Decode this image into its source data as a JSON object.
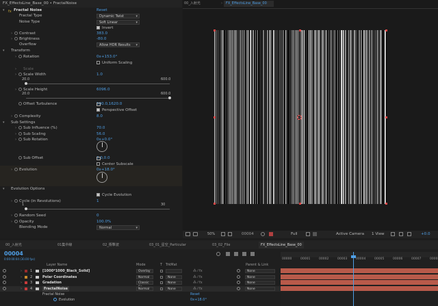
{
  "effect_controls": {
    "panel_title": "FX_EffectsLine_Base_00 • FractalNoise",
    "effect_name": "Fractal Noise",
    "reset_label": "Reset",
    "props": [
      {
        "label": "Fractal Type",
        "value": "Dynamic Twist"
      },
      {
        "label": "Noise Type",
        "value": "Soft Linear"
      },
      {
        "label": "",
        "value": "Invert"
      },
      {
        "label": "Contrast",
        "value": "383.0"
      },
      {
        "label": "Brightness",
        "value": "-80.0"
      },
      {
        "label": "Overflow",
        "value": "Allow HDR Results"
      },
      {
        "label": "Transform",
        "value": ""
      },
      {
        "label": "Rotation",
        "value": "0x+153.0°"
      },
      {
        "label": "",
        "value": "Uniform Scaling"
      },
      {
        "label": "Scale",
        "value": ""
      },
      {
        "label": "Scale Width",
        "value": "1.0"
      },
      {
        "label": "Scale Height",
        "value": "6096.0"
      },
      {
        "label": "Offset Turbulence",
        "value": "500.0,1620.0"
      },
      {
        "label": "",
        "value": "Perspective Offset"
      },
      {
        "label": "Complexity",
        "value": "8.0"
      },
      {
        "label": "Sub Settings",
        "value": ""
      },
      {
        "label": "Sub Influence (%)",
        "value": "70.0"
      },
      {
        "label": "Sub Scaling",
        "value": "56.0"
      },
      {
        "label": "Sub Rotation",
        "value": "0x+0.0°"
      },
      {
        "label": "Sub Offset",
        "value": "0.0,0.0"
      },
      {
        "label": "",
        "value": "Center Subscale"
      },
      {
        "label": "Evolution",
        "value": "0x+18.0°"
      },
      {
        "label": "Evolution Options",
        "value": ""
      },
      {
        "label": "",
        "value": "Cycle Evolution"
      },
      {
        "label": "Cycle (in Revolutions)",
        "value": "1"
      },
      {
        "label": "Random Seed",
        "value": "0"
      },
      {
        "label": "Opacity",
        "value": "100.0%"
      },
      {
        "label": "Blending Mode",
        "value": "Normal"
      }
    ],
    "scale_width_range": {
      "min": "20.0",
      "max": "600.0",
      "fraction": 0.0
    },
    "scale_height_range": {
      "min": "20.0",
      "max": "600.0",
      "fraction": 1.0
    },
    "cycle_range": {
      "min": "1",
      "max": "30",
      "fraction": 0.0
    }
  },
  "comp_viewer": {
    "tabs": [
      "00_入射光",
      "FX_EffectsLine_Base_00"
    ],
    "zoom": "50%",
    "timecode": "00004",
    "resolution": "Full",
    "camera": "Active Camera",
    "view": "1 View",
    "accent": "#4f9fe6"
  },
  "timeline": {
    "tabs": [
      "00_入射光",
      "01集中線",
      "02_衝撃波",
      "03_01_星空_Particular",
      "03_02_Flie",
      "FX_EffectsLine_Base_00"
    ],
    "current_time": "00004",
    "fps_note": "0:00:00:04 (30.00 fps)",
    "col_layer_name": "Layer Name",
    "col_mode": "Mode",
    "col_t": "T",
    "col_trkmat": "TrkMat",
    "col_parent": "Parent & Link",
    "ruler": [
      "00000",
      "00001",
      "00002",
      "00003",
      "00004",
      "00005",
      "00006",
      "00007",
      "00008"
    ],
    "layers": [
      {
        "num": "1",
        "name": "[1000*1000_Black_Solid]",
        "mode": "Overlay",
        "trkmat": "",
        "parent": "None",
        "color": "#9b2b2b",
        "bar": "#b85a4a"
      },
      {
        "num": "2",
        "name": "Polar Coordinates",
        "mode": "Normal",
        "trkmat": "None",
        "parent": "None",
        "color": "#c98a2b",
        "bar": "#b85a4a"
      },
      {
        "num": "3",
        "name": "Gradation",
        "mode": "Classic Co",
        "trkmat": "None",
        "parent": "None",
        "color": "#c83b3b",
        "bar": "#b85a4a"
      },
      {
        "num": "4",
        "name": "FractalNoise",
        "mode": "Normal",
        "trkmat": "None",
        "parent": "None",
        "color": "#c83b3b",
        "bar": "#b85a4a"
      }
    ],
    "sub_effect": "Fractal Noise",
    "sub_reset": "Reset",
    "sub_prop": "Evolution",
    "sub_value": "0x+18.0°"
  }
}
